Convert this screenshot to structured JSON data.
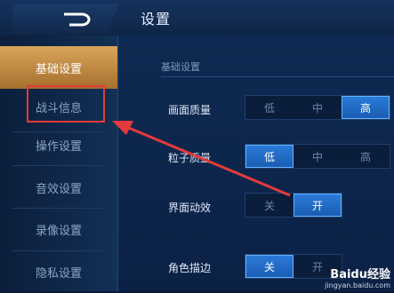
{
  "header": {
    "title": "设置"
  },
  "sidebar": {
    "items": [
      {
        "label": "基础设置",
        "active": true
      },
      {
        "label": "战斗信息",
        "active": false
      },
      {
        "label": "操作设置",
        "active": false
      },
      {
        "label": "音效设置",
        "active": false
      },
      {
        "label": "录像设置",
        "active": false
      },
      {
        "label": "隐私设置",
        "active": false
      }
    ]
  },
  "content": {
    "section_title": "基础设置",
    "rows": [
      {
        "label": "画面质量",
        "options": [
          "低",
          "中",
          "高"
        ],
        "selected": "高"
      },
      {
        "label": "粒子质量",
        "options": [
          "低",
          "中",
          "高"
        ],
        "selected": "低"
      },
      {
        "label": "界面动效",
        "options": [
          "关",
          "开"
        ],
        "selected": "开"
      },
      {
        "label": "角色描边",
        "options": [
          "关",
          "开"
        ],
        "selected": "关"
      }
    ]
  },
  "watermark": {
    "logo": "Baidu经验",
    "url": "jingyan.baidu.com"
  },
  "colors": {
    "accent_blue": "#2b7ad8",
    "active_tab_gold": "#d9a55a",
    "annotation_red": "#e33b3b"
  }
}
